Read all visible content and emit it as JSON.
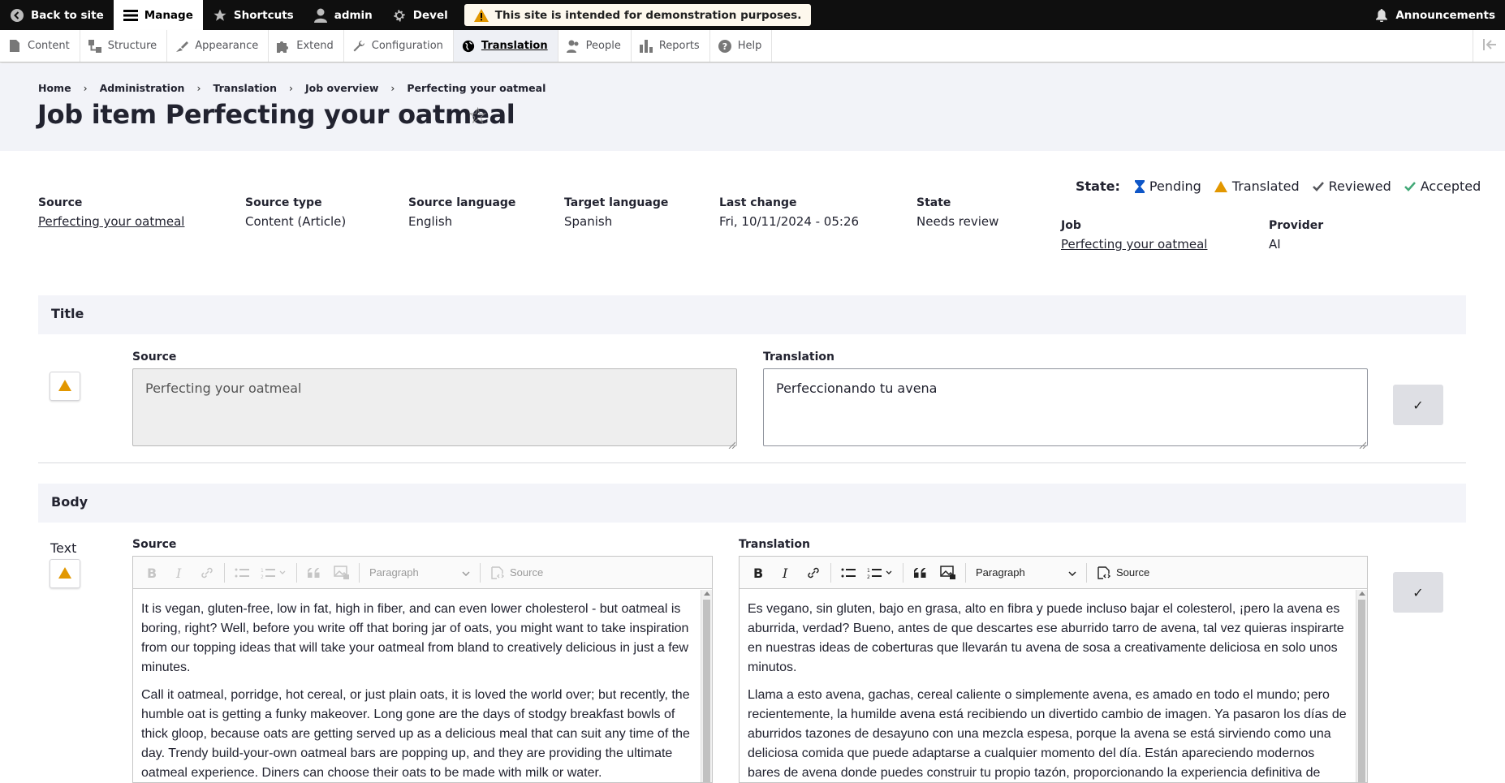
{
  "toolbar": {
    "back": "Back to site",
    "manage": "Manage",
    "shortcuts": "Shortcuts",
    "user": "admin",
    "devel": "Devel",
    "warning": "This site is intended for demonstration purposes.",
    "announcements": "Announcements"
  },
  "tray": {
    "items": [
      "Content",
      "Structure",
      "Appearance",
      "Extend",
      "Configuration",
      "Translation",
      "People",
      "Reports",
      "Help"
    ]
  },
  "breadcrumb": [
    "Home",
    "Administration",
    "Translation",
    "Job overview",
    "Perfecting your oatmeal"
  ],
  "page": {
    "title": "Job item Perfecting your oatmeal",
    "star": "☆"
  },
  "state_legend": {
    "title": "State:",
    "items": [
      "Pending",
      "Translated",
      "Reviewed",
      "Accepted"
    ]
  },
  "meta": {
    "source_label": "Source",
    "source_value": "Perfecting your oatmeal",
    "source_type_label": "Source type",
    "source_type_value": "Content (Article)",
    "source_language_label": "Source language",
    "source_language_value": "English",
    "target_language_label": "Target language",
    "target_language_value": "Spanish",
    "last_change_label": "Last change",
    "last_change_value": "Fri, 10/11/2024 - 05:26",
    "state_label": "State",
    "state_value": "Needs review",
    "job_label": "Job",
    "job_value": "Perfecting your oatmeal",
    "provider_label": "Provider",
    "provider_value": "AI"
  },
  "title_section": {
    "heading": "Title",
    "source_label": "Source",
    "source_value": "Perfecting your oatmeal",
    "translation_label": "Translation",
    "translation_value": "Perfeccionando tu avena",
    "check": "✓"
  },
  "body_section": {
    "heading": "Body",
    "field_label": "Text",
    "source_label": "Source",
    "translation_label": "Translation",
    "paragraph_format": "Paragraph",
    "source_button": "Source",
    "check": "✓",
    "source_p1": "It is vegan, gluten-free, low in fat, high in fiber, and can even lower cholesterol - but oatmeal is boring, right? Well, before you write off that boring jar of oats, you might want to take in­spiration from our topping ideas that will take your oatmeal from bland to creatively delicious in just a few minutes.",
    "source_p2": "Call it oatmeal, porridge, hot cereal, or just plain oats, it is loved the world over; but recently, the humble oat is getting a funky makeover. Long gone are the days of stodgy breakfast bowls of thick gloop, because oats are getting served up as a delicious meal that can suit any time of the day. Trendy build-your-own oatmeal bars are popping up, and they are providing the ultimate oatmeal experience. Diners can choose their oats to be made with milk or water.",
    "translation_p1": "Es vegano, sin gluten, bajo en grasa, alto en fibra y puede incluso bajar el colesterol, ¡pero la avena es aburrida, verdad? Bueno, antes de que descartes ese aburrido tarro de avena, tal vez quieras inspi­rarte en nuestras ideas de coberturas que llevarán tu avena de sosa a creativamente deliciosa en solo unos minutos.",
    "translation_p2": "Llama a esto avena, gachas, cereal caliente o simplemente avena, es amado en todo el mundo; pero recientemente, la humilde avena está recibiendo un divertido cambio de imagen. Ya pasaron los días de aburridos tazones de desayuno con una mezcla espesa, porque la avena se está sirviendo como una deliciosa comida que puede adaptarse a cualquier momento del día. Están apareciendo modernos bares de avena donde puedes construir tu propio tazón, proporcionando la experiencia definitiva de avena."
  },
  "colors": {
    "link": "#003ecc",
    "pending": "#0e56c7",
    "translated": "#e29700",
    "accepted": "#42a877"
  }
}
